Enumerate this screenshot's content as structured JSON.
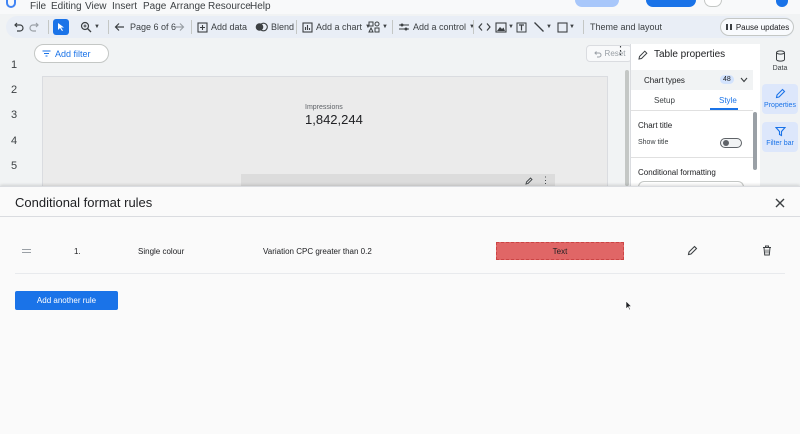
{
  "menu": {
    "items": [
      "File",
      "Editing",
      "View",
      "Insert",
      "Page",
      "Arrange",
      "Resource",
      "Help"
    ]
  },
  "toolbar": {
    "page_label": "Page 6 of 6",
    "add_data": "Add data",
    "blend": "Blend",
    "add_chart": "Add a chart",
    "add_control": "Add a control",
    "theme_layout": "Theme and layout",
    "pause_updates": "Pause updates"
  },
  "canvas": {
    "row_numbers": [
      "1",
      "2",
      "3",
      "4",
      "5"
    ],
    "add_filter": "Add filter",
    "reset": "Reset",
    "scorecard": {
      "label": "Impressions",
      "value": "1,842,244"
    }
  },
  "properties_panel": {
    "title": "Table properties",
    "chart_types_label": "Chart types",
    "chart_types_count": "48",
    "tabs": [
      "Setup",
      "Style"
    ],
    "active_tab": "Style",
    "chart_title_section": "Chart title",
    "show_title_label": "Show title",
    "conditional_formatting_section": "Conditional formatting"
  },
  "right_rail": {
    "items": [
      "Data",
      "Properties",
      "Filter bar"
    ],
    "active": "Properties"
  },
  "modal": {
    "title": "Conditional format rules",
    "rules": [
      {
        "index": "1.",
        "type": "Single colour",
        "condition": "Variation CPC greater than 0.2",
        "preview_text": "Text",
        "preview_color": "#e06666"
      }
    ],
    "add_rule_button": "Add another rule"
  },
  "colors": {
    "accent": "#1a73e8",
    "rule_fill": "#e06666"
  }
}
